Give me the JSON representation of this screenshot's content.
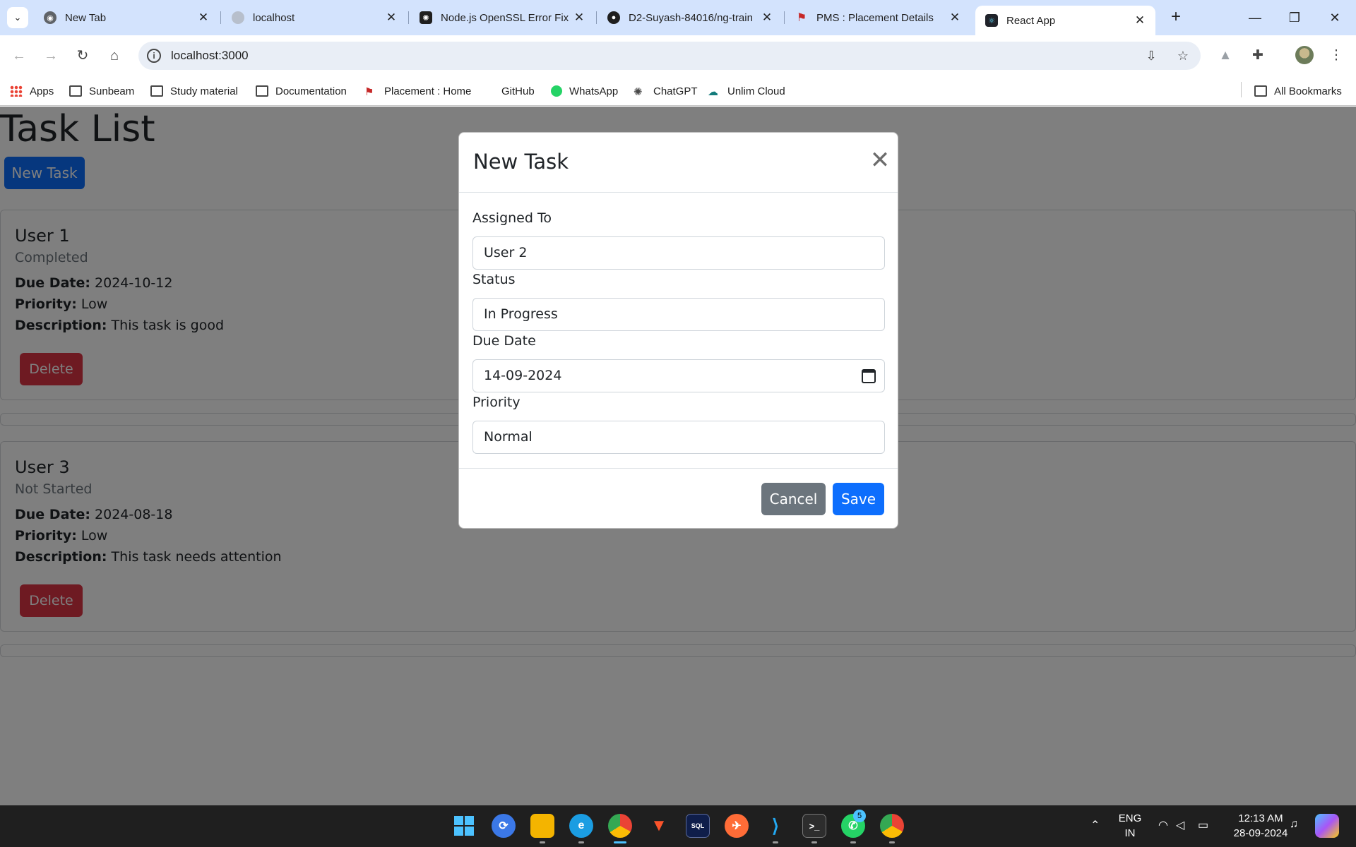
{
  "browser": {
    "tabs": [
      {
        "title": "New Tab"
      },
      {
        "title": "localhost"
      },
      {
        "title": "Node.js OpenSSL Error Fix"
      },
      {
        "title": "D2-Suyash-84016/ng-train"
      },
      {
        "title": "PMS : Placement Details"
      },
      {
        "title": "React App"
      }
    ],
    "url": "localhost:3000",
    "bookmarks": [
      "Apps",
      "Sunbeam",
      "Study material",
      "Documentation",
      "Placement : Home",
      "GitHub",
      "WhatsApp",
      "ChatGPT",
      "Unlim Cloud"
    ],
    "all_bookmarks": "All Bookmarks"
  },
  "page": {
    "title": "Task List",
    "new_task_label": "New Task",
    "tasks": [
      {
        "name": "User 1",
        "status": "Completed",
        "due_label": "Due Date:",
        "due": "2024-10-12",
        "priority_label": "Priority:",
        "priority": "Low",
        "desc_label": "Description:",
        "description": "This task is good",
        "delete_label": "Delete"
      },
      {
        "name": "User 3",
        "status": "Not Started",
        "due_label": "Due Date:",
        "due": "2024-08-18",
        "priority_label": "Priority:",
        "priority": "Low",
        "desc_label": "Description:",
        "description": "This task needs attention",
        "delete_label": "Delete"
      }
    ]
  },
  "modal": {
    "title": "New Task",
    "fields": [
      {
        "label": "Assigned To",
        "value": "User 2"
      },
      {
        "label": "Status",
        "value": "In Progress"
      },
      {
        "label": "Due Date",
        "value": "14-09-2024"
      },
      {
        "label": "Priority",
        "value": "Normal"
      }
    ],
    "cancel_label": "Cancel",
    "save_label": "Save"
  },
  "taskbar": {
    "whatsapp_badge": "5",
    "language": "ENG",
    "region": "IN",
    "time": "12:13 AM",
    "date": "28-09-2024"
  },
  "colors": {
    "primary": "#0d6efd",
    "danger": "#dc3545",
    "secondary": "#6c757d",
    "tabstrip": "#d3e3fd"
  }
}
